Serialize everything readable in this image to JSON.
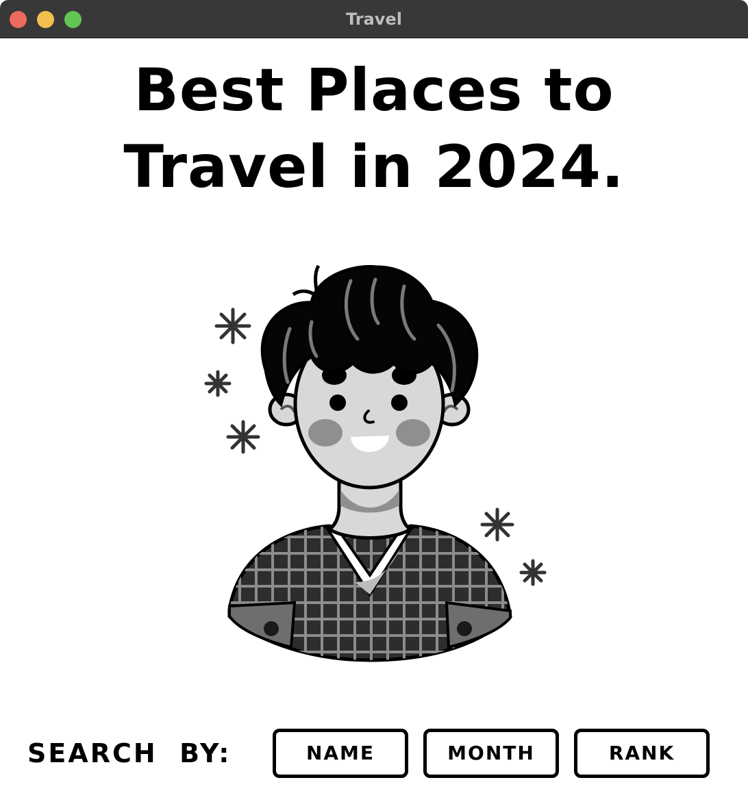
{
  "window": {
    "title": "Travel"
  },
  "headline": {
    "line1": "Best Places to",
    "line2": "Travel in 2024."
  },
  "illustration": {
    "icon": "person-avatar-illustration"
  },
  "search": {
    "label": "SEARCH  BY:",
    "buttons": [
      {
        "label": "NAME"
      },
      {
        "label": "MONTH"
      },
      {
        "label": "RANK"
      }
    ]
  },
  "colors": {
    "titlebar": "#383838",
    "close": "#ed6a5e",
    "minimize": "#f5bf4f",
    "maximize": "#61c554",
    "text": "#000000",
    "background": "#ffffff"
  }
}
